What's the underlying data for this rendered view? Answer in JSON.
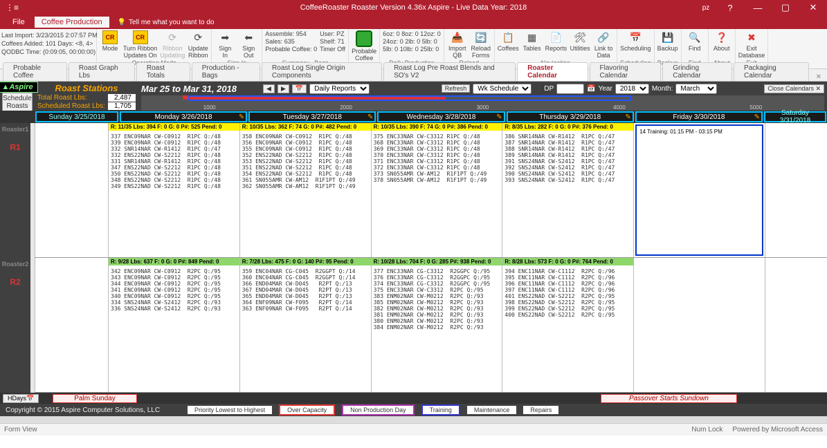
{
  "title": "CoffeeRoaster Roaster Version 4.36x  Aspire  - Live Data   Year: 2018",
  "user": "pz",
  "menu": {
    "file": "File",
    "coffee": "Coffee Production",
    "tellme": "Tell me what you want to do"
  },
  "info": {
    "lastimport": "Last Import: 3/23/2015 2:07:57 PM",
    "coffees": "Coffees Added:  101     Days: <8, 4>",
    "qodbc": "QODBC Time: (0:09:05, 00:00:00)"
  },
  "ribbon": {
    "opmode": {
      "label": "Operating Mode",
      "mode": "Mode",
      "turn": "Turn Ribbon\nUpdates On",
      "ribbon": "Ribbon\nUpdating",
      "update": "Update\nRibbon"
    },
    "signin": {
      "label": "Sign In",
      "in": "Sign\nIn",
      "out": "Sign\nOut"
    },
    "summary": {
      "label": "Summary - Bags",
      "assemble": "Assemble: 954",
      "sales": "Sales:     635",
      "prob": "Probable Coffee: 0",
      "user": "User: PZ",
      "shelf": "Shelf: 71",
      "timer": "Timer Off"
    },
    "probable": {
      "label": "Probable\nCoffee"
    },
    "daily": {
      "label": "Daily Production",
      "c1": "6oz:  0   8oz:  0   12oz:  0",
      "c2": "24oz: 0   2lb:  0   5lb:  0",
      "c3": "5lb:  0   10lb: 0   25lb: 0"
    },
    "reload": {
      "label": "Reload",
      "import": "Import\nQB",
      "reload": "Reload\nForms"
    },
    "nav": {
      "label": "Navigation",
      "coffees": "Coffees",
      "tables": "Tables",
      "reports": "Reports",
      "util": "Utilities",
      "link": "Link to\nData"
    },
    "sched": {
      "label": "Scheduling",
      "s": "Scheduling"
    },
    "backup": {
      "label": "Backup",
      "b": "Backup"
    },
    "find": {
      "label": "Find",
      "f": "Find"
    },
    "about": {
      "label": "About",
      "a": "About"
    },
    "exit": {
      "label": "Exit",
      "e": "Exit\nDatabase"
    }
  },
  "tabs": [
    "Probable Coffee",
    "Roast Graph Lbs",
    "Roast Totals",
    "Production - Bags",
    "Roast Log Single Origin Components",
    "Roast Log Pre Roast Blends and SO's V2",
    "Roaster Calendar",
    "Flavoring Calendar",
    "Grinding Calendar",
    "Packaging Calendar"
  ],
  "activeTab": 6,
  "ctrl": {
    "roaststations": "Roast Stations",
    "total": "Total Roast Lbs:",
    "totalv": "2,487",
    "sched": "Scheduled Roast Lbs:",
    "schedv": "1,705",
    "daterange": "Mar 25 to Mar 31, 2018",
    "daily": "Daily Reports",
    "refresh": "Refresh",
    "wk": "Wk Schedule",
    "dp": "DP",
    "year": "Year",
    "yearv": "2018",
    "month": "Month:",
    "monthv": "March",
    "close": "Close Calendars",
    "schedbtn": "Schedule\nRoasts"
  },
  "days": [
    "Sunday  3/25/2018",
    "Monday  3/26/2018",
    "Tuesday  3/27/2018",
    "Wednesday  3/28/2018",
    "Thursday  3/29/2018",
    "Friday  3/30/2018",
    "Saturday  3/31/2018"
  ],
  "r1": {
    "name": "Roaster1",
    "id": "R1",
    "mon": {
      "hdr": "R: 11/35   Lbs: 394  F: 0  G: 0  P#: 525  Pend: 0",
      "items": "337 ENC09NAR CW-C0912  R1PC Q:/48\n339 ENC09NAR CW-C0912  R1PC Q:/48\n332 SNR14NAR CW-R1412  R1PC Q:/47\n332 ENS22NAD CW-S2212  R1PC Q:/48\n331 SNR14NAR CW-R1412  R1PC Q:/48\n347 ENS22NAD CW-S2212  R1PC Q:/48\n350 ENS22NAD CW-S2212  R1PC Q:/48\n348 ENS22NAD CW-S2212  R1PC Q:/48\n349 ENS22NAD CW-S2212  R1PC Q:/48"
    },
    "tue": {
      "hdr": "R: 10/35   Lbs: 362  F: 74  G: 0  P#: 482  Pend: 0",
      "items": "358 ENC09NAR CW-C0912  R1PC Q:/48\n356 ENC09NAR CW-C0912  R1PC Q:/48\n355 ENC09NAR CW-C0912  R1PC Q:/48\n352 ENS22NAD CW-S2212  R1PC Q:/48\n353 ENS22NAD CW-S2212  R1PC Q:/48\n351 ENS22NAD CW-S2212  R1PC Q:/48\n354 ENS22NAD CW-S2212  R1PC Q:/48\n361 SN055AMR CW-AM12  R1F1PT Q:/49\n362 SN055AMR CW-AM12  R1F1PT Q:/49"
    },
    "wed": {
      "hdr": "R: 10/35   Lbs: 390  F: 74  G: 0  P#: 386  Pend: 0",
      "items": "375 ENC33NAR CW-C3312 R1PC Q:/48\n368 ENC33NAR CW-C3312 R1PC Q:/48\n369 ENC33NAR CW-C3312 R1PC Q:/48\n370 ENC33NAR CW-C3312 R1PC Q:/48\n371 ENC33NAR CW-C3312 R1PC Q:/48\n372 ENC33NAR CW-C3312 R1PC Q:/48\n373 SN055AMR CW-AM12  R1F1PT Q:/49\n378 SN055AMR CW-AM12  R1F1PT Q:/49"
    },
    "thu": {
      "hdr": "R: 8/35   Lbs: 282  F: 0  G: 0  P#: 376  Pend: 0",
      "items": "386 SNR14NAR CW-R1412  R1PC Q:/47\n387 SNR14NAR CW-R1412  R1PC Q:/47\n388 SNR14NAR CW-R1412  R1PC Q:/47\n389 SNR14NAR CW-R1412  R1PC Q:/47\n391 SNS24NAR CW-S2412  R1PC Q:/47\n392 SNS24NAR CW-S2412  R1PC Q:/47\n390 SNS24NAR CW-S2412  R1PC Q:/47\n393 SNS24NAR CW-S2412  R1PC Q:/47"
    },
    "fri": "14   Training:  01:15 PM - 03:15 PM"
  },
  "r2": {
    "name": "Roaster2",
    "id": "R2",
    "mon": {
      "hdr": "R: 9/28   Lbs: 637  F: 0  G: 0  P#: 849  Pend: 0",
      "items": "342 ENC09NAR CW-C0912  R2PC Q:/95\n343 ENC09NAR CW-C0912  R2PC Q:/95\n344 ENC09NAR CW-C0912  R2PC Q:/95\n341 ENC09NAR CW-C0912  R2PC Q:/95\n340 ENC09NAR CW-C0912  R2PC Q:/95\n334 SNS24NAR CW-S2412  R2PC Q:/93\n336 SNS24NAR CW-S2412  R2PC Q:/93"
    },
    "tue": {
      "hdr": "R: 7/28   Lbs: 475  F: 0  G: 140  P#: 95  Pend: 0",
      "items": "359 ENC04NAR CG-C045  R2GGPT Q:/14\n360 ENC04NAR CG-C045  R2GGPT Q:/14\n366 END04MAR CW-D045   R2PT Q:/13\n367 END04MAR CW-D045   R2PT Q:/13\n365 END04MAR CW-D045   R2PT Q:/13\n364 ENF09NAR CW-F095   R2PT Q:/14\n363 ENF09NAR CW-F095   R2PT Q:/14"
    },
    "wed": {
      "hdr": "R: 10/28   Lbs: 704  F: 0  G: 285  P#: 938  Pend: 0",
      "items": "377 ENC33NAR CG-C3312  R2GGPC Q:/95\n376 ENC33NAR CG-C3312  R2GGPC Q:/95\n374 ENC33NAR CG-C3312  R2GGPC Q:/95\n375 ENC33NAR CW-C3312  R2PC Q:/95\n383 ENM02NAR CW-M0212  R2PC Q:/93\n385 ENM02NAR CW-M0212  R2PC Q:/93\n382 ENM02NAR CW-M0212  R2PC Q:/93\n381 ENM02NAR CW-M0212  R2PC Q:/93\n380 ENM02NAR CW-M0212  R2PC Q:/93\n384 ENM02NAR CW-M0212  R2PC Q:/93"
    },
    "thu": {
      "hdr": "R: 8/28   Lbs: 573  F: 0  G: 0  P#: 764  Pend: 0",
      "items": "394 ENC11NAR CW-C1112  R2PC Q:/96\n395 ENC11NAR CW-C1112  R2PC Q:/96\n396 ENC11NAR CW-C1112  R2PC Q:/96\n397 ENC11NAR CW-C1112  R2PC Q:/96\n401 ENS22NAD CW-S2212  R2PC Q:/95\n398 ENS22NAD CW-S2212  R2PC Q:/95\n399 ENS22NAD CW-S2212  R2PC Q:/95\n400 ENS22NAD CW-S2212  R2PC Q:/95"
    }
  },
  "holidays": {
    "btn": "HDays",
    "palm": "Palm Sunday",
    "passover": "Passover Starts Sundown"
  },
  "legend": {
    "copy": "Copyright © 2015 Aspire Computer Solutions, LLC",
    "prio": "Priority Lowest to Highest",
    "over": "Over Capacity",
    "nonprod": "Non Production Day",
    "train": "Training",
    "maint": "Maintenance",
    "repairs": "Repairs"
  },
  "status": {
    "view": "Form View",
    "numlock": "Num Lock",
    "powered": "Powered by Microsoft Access"
  },
  "ticks": [
    "1000",
    "2000",
    "3000",
    "4000",
    "5000"
  ]
}
